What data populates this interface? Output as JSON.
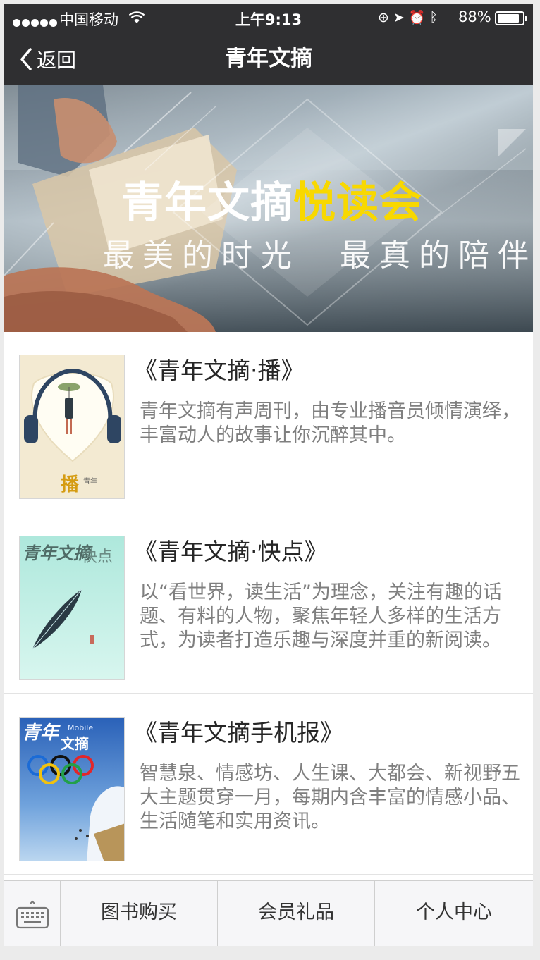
{
  "status_bar": {
    "carrier": "中国移动",
    "time": "上午9:13",
    "battery": "88%",
    "battery_level": 0.88,
    "icons": [
      "orientation-lock-icon",
      "location-icon",
      "alarm-icon",
      "bluetooth-icon"
    ]
  },
  "nav": {
    "back_label": "返回",
    "title": "青年文摘"
  },
  "banner": {
    "title_main": "青年文摘",
    "title_highlight": "悦读会",
    "subtitle": "最美的时光　最真的陪伴",
    "highlight_color": "#f8d800"
  },
  "items": [
    {
      "title": "《青年文摘·播》",
      "description": "青年文摘有声周刊，由专业播音员倾情演绎，丰富动人的故事让你沉醉其中。",
      "cover_icon": "headphones-girl-cover"
    },
    {
      "title": "《青年文摘·快点》",
      "description": "以“看世界，读生活”为理念，关注有趣的话题、有料的人物，聚焦年轻人多样的生活方式，为读者打造乐趣与深度并重的新阅读。",
      "cover_icon": "feather-cover"
    },
    {
      "title": "《青年文摘手机报》",
      "description": "智慧泉、情感坊、人生课、大都会、新视野五大主题贯穿一月，每期内含丰富的情感小品、生活随笔和实用资讯。",
      "cover_icon": "olympic-rings-cover"
    }
  ],
  "bottom_bar": {
    "tabs": [
      "图书购买",
      "会员礼品",
      "个人中心"
    ]
  }
}
